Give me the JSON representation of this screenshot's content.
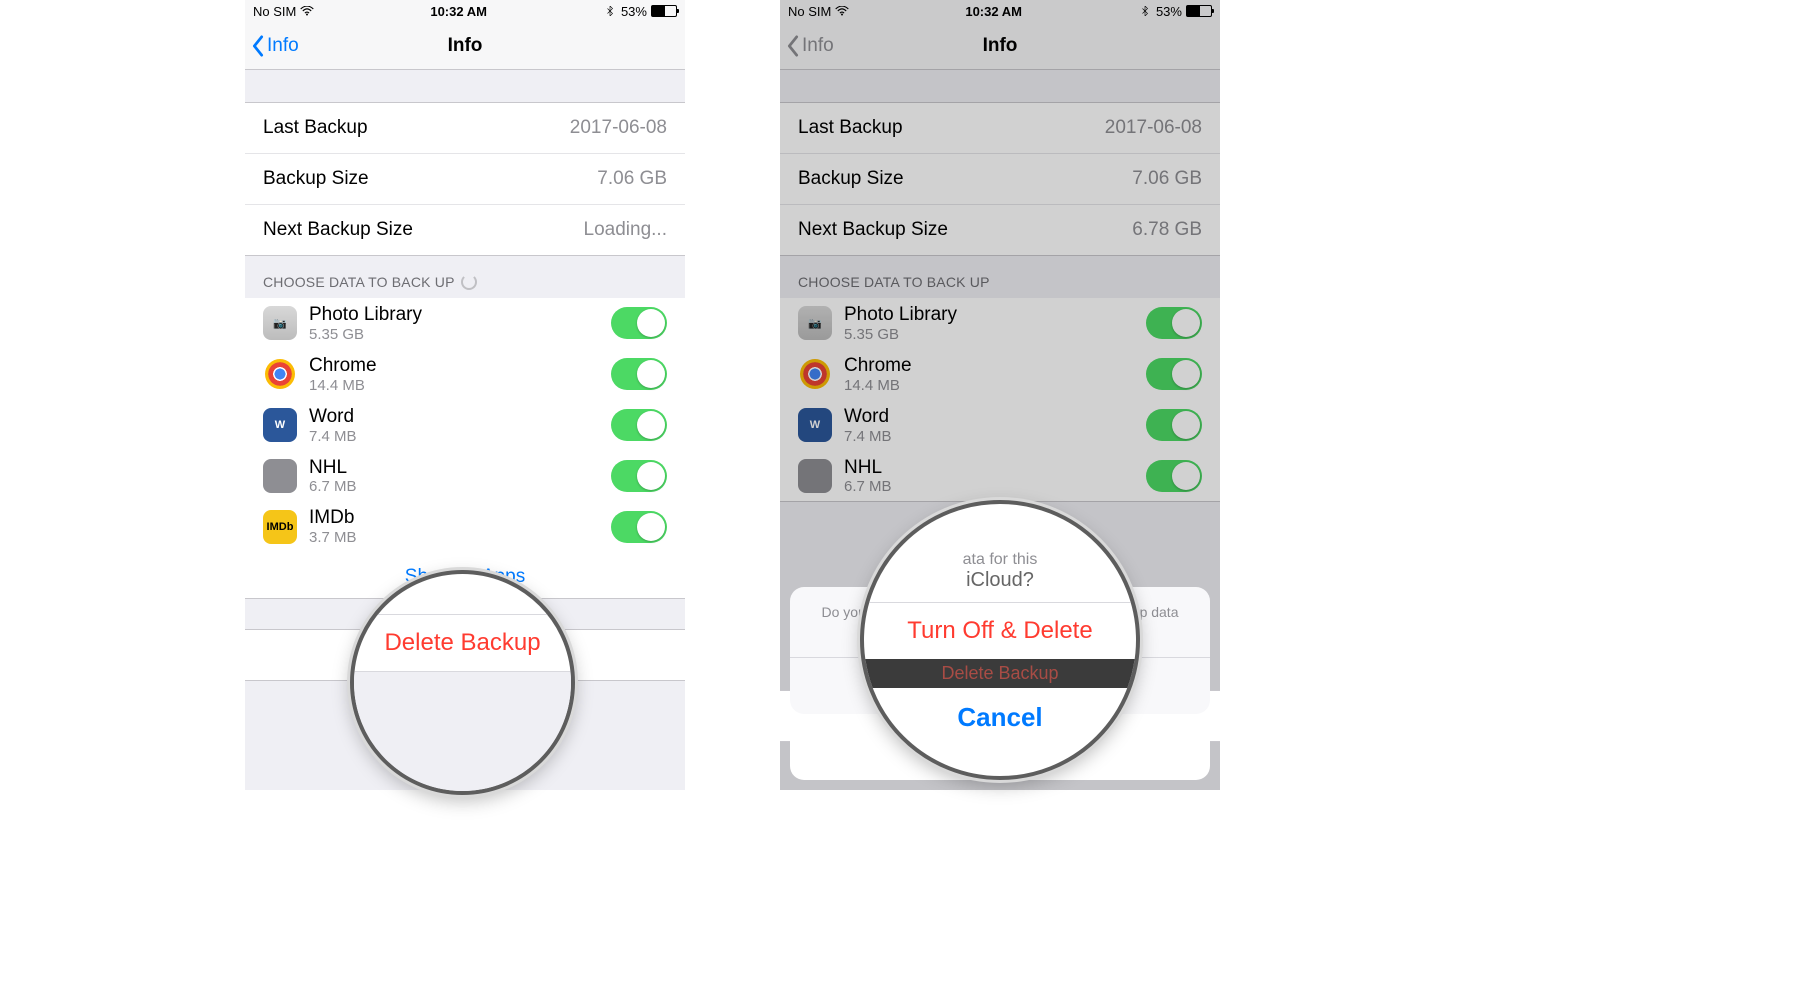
{
  "statusbar": {
    "carrier": "No SIM",
    "time": "10:32 AM",
    "battery_pct": "53%"
  },
  "nav": {
    "back_label": "Info",
    "title": "Info"
  },
  "backup_info": {
    "last_backup_label": "Last Backup",
    "last_backup_value": "2017-06-08",
    "backup_size_label": "Backup Size",
    "backup_size_value": "7.06 GB",
    "next_backup_label": "Next Backup Size",
    "next_backup_value_left": "Loading...",
    "next_backup_value_right": "6.78 GB"
  },
  "choose_header": "CHOOSE DATA TO BACK UP",
  "apps": [
    {
      "name": "Photo Library",
      "size": "5.35 GB",
      "icon": "photo"
    },
    {
      "name": "Chrome",
      "size": "14.4 MB",
      "icon": "chrome"
    },
    {
      "name": "Word",
      "size": "7.4 MB",
      "icon": "word"
    },
    {
      "name": "NHL",
      "size": "6.7 MB",
      "icon": "nhl"
    },
    {
      "name": "IMDb",
      "size": "3.7 MB",
      "icon": "imdb"
    }
  ],
  "show_all_label": "Show All Apps",
  "delete_backup_label": "Delete Backup",
  "action_sheet": {
    "message": "Do you want to turn off backup and delete all backup data for this iPhone from iCloud?",
    "message_frag_top": "Do you want ata for this up and delete",
    "message_frag_mid": "all ba iCloud? e from",
    "turn_off_label": "Turn Off & Delete",
    "cancel_label": "Cancel"
  },
  "magnifier_left": {
    "text": "Delete Backup"
  },
  "magnifier_right": {
    "small1": "ata for this",
    "small2": "iCloud?",
    "btn1": "Turn Off & Delete",
    "strip": "Delete Backup",
    "btn2": "Cancel"
  },
  "icon_labels": {
    "word": "W",
    "imdb": "IMDb",
    "camera": "📷"
  }
}
